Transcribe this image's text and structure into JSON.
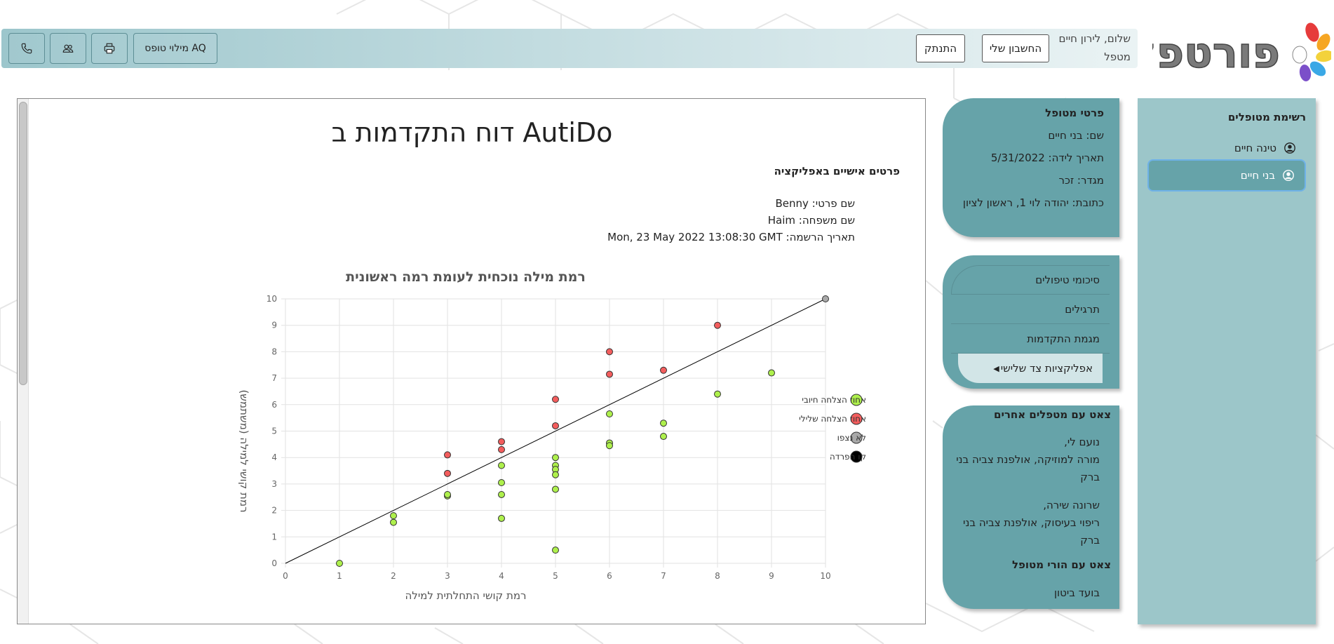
{
  "header": {
    "greeting_line1": "שלום, לירון חיים",
    "greeting_line2": "מטפל",
    "my_account_button": "החשבון שלי",
    "logout_button": "התנתק",
    "aq_form_button": "מילוי טופס AQ"
  },
  "logo": {
    "text": "פורטפל"
  },
  "sidebar": {
    "title": "רשימת מטופלים",
    "patients": [
      {
        "name": "טינה חיים"
      },
      {
        "name": "בני חיים"
      }
    ]
  },
  "patient_details": {
    "title": "פרטי מטופל",
    "name": "שם:  בני חיים",
    "birthdate": "תאריך לידה:  5/31/2022",
    "gender": "מגדר:  זכר",
    "address": "כתובת:  יהודה לוי 1, ראשון לציון"
  },
  "menu": {
    "items": [
      "סיכומי טיפולים",
      "תרגילים",
      "מגמת התקדמות",
      "אפליקציות צד שלישי"
    ]
  },
  "chat": {
    "other_therapists_title": "צאט עם מטפלים אחרים",
    "therapists": [
      {
        "name": "נועם לי,",
        "role": "מורה למוזיקה, אולפנת צביה בני ברק"
      },
      {
        "name": "שרונה שירה,",
        "role": "ריפוי בעיסוק, אולפנת צביה בני ברק"
      }
    ],
    "parents_title": "צאט עם הורי מטופל",
    "parents_entry": "בועד ביטון"
  },
  "report": {
    "title": "דוח התקדמות ב AutiDo",
    "personal_title": "פרטים אישיים באפליקציה",
    "first_name": "שם פרטי: Benny",
    "last_name": "שם משפחה: Haim",
    "registration": "תאריך הרשמה: Mon, 23 May 2022 13:08:30 GMT"
  },
  "colors": {
    "positive": "#aef04c",
    "negative": "#f35d5d",
    "not_encountered": "#a9a9a9",
    "separator": "#000000",
    "panel": "#66a3a9",
    "sidebar": "#9cc6c9"
  },
  "chart_data": {
    "type": "scatter",
    "title": "רמת מילה נוכחית לעומת רמה ראשונית",
    "xlabel": "רמת קושי התחלתית למילה",
    "ylabel": "רמת קושי למילה (משתמש)",
    "xlim": [
      0,
      10
    ],
    "ylim": [
      0,
      10
    ],
    "xticks": [
      "0",
      "1",
      "2",
      "3",
      "4",
      "5",
      "6",
      "7",
      "8",
      "9",
      "10"
    ],
    "yticks": [
      "0",
      "1",
      "2",
      "3",
      "4",
      "5",
      "6",
      "7",
      "8",
      "9",
      "10"
    ],
    "grid": true,
    "legend_position": "right",
    "legend": [
      "אחוז הצלחה חיובי",
      "אחוז הצלחה שלילי",
      "לא נצפו",
      "קו הפרדה"
    ],
    "series": [
      {
        "name": "אחוז הצלחה חיובי",
        "color": "#aef04c",
        "points": [
          [
            1,
            0
          ],
          [
            2,
            1.8
          ],
          [
            2,
            1.55
          ],
          [
            3,
            2.55
          ],
          [
            3,
            2.6
          ],
          [
            4,
            3.7
          ],
          [
            4,
            3.05
          ],
          [
            4,
            2.6
          ],
          [
            4,
            1.7
          ],
          [
            5,
            4
          ],
          [
            5,
            3.7
          ],
          [
            5,
            3.55
          ],
          [
            5,
            3.35
          ],
          [
            5,
            2.8
          ],
          [
            5,
            0.5
          ],
          [
            6,
            5.65
          ],
          [
            6,
            4.55
          ],
          [
            6,
            4.45
          ],
          [
            7,
            5.3
          ],
          [
            7,
            4.8
          ],
          [
            8,
            6.4
          ],
          [
            9,
            7.2
          ]
        ]
      },
      {
        "name": "אחוז הצלחה שלילי",
        "color": "#f35d5d",
        "points": [
          [
            3,
            4.1
          ],
          [
            3,
            3.4
          ],
          [
            4,
            4.6
          ],
          [
            4,
            4.3
          ],
          [
            5,
            6.2
          ],
          [
            5,
            5.2
          ],
          [
            6,
            8
          ],
          [
            6,
            7.15
          ],
          [
            7,
            7.3
          ],
          [
            8,
            9
          ]
        ]
      },
      {
        "name": "לא נצפו",
        "color": "#a9a9a9",
        "points": [
          [
            10,
            10
          ]
        ]
      }
    ],
    "separator_line": [
      [
        0,
        0
      ],
      [
        10,
        10
      ]
    ]
  }
}
